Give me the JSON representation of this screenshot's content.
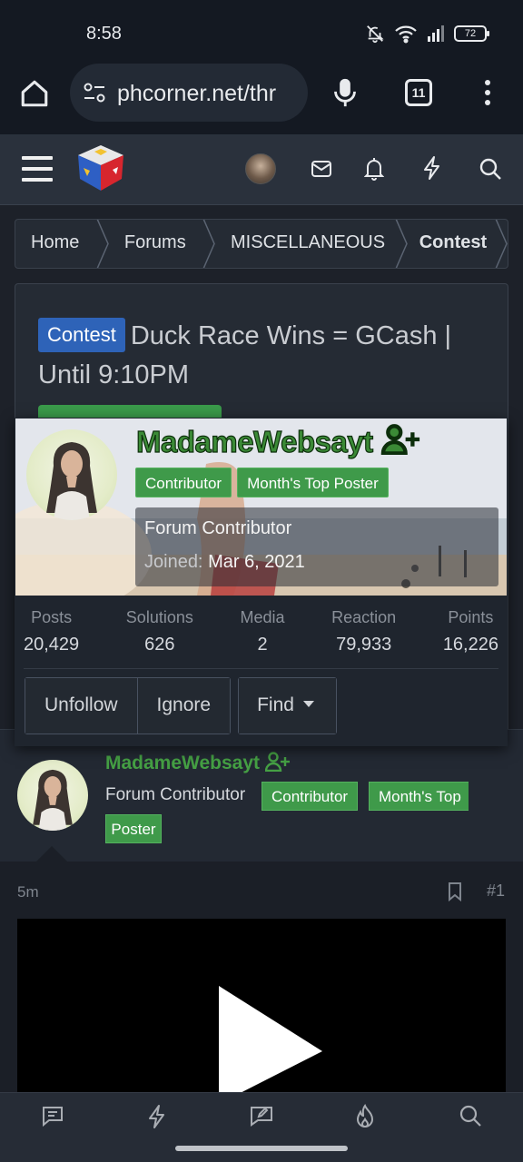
{
  "status_bar": {
    "time": "8:58",
    "battery": "72"
  },
  "browser": {
    "url": "phcorner.net/thr",
    "tab_count": "11"
  },
  "breadcrumb": [
    "Home",
    "Forums",
    "MISCELLANEOUS",
    "Contest"
  ],
  "thread": {
    "prefix": "Contest",
    "title": "Duck Race Wins = GCash | Until 9:10PM"
  },
  "member_card": {
    "username": "MadameWebsayt",
    "badges": [
      "Contributor",
      "Month's Top Poster"
    ],
    "user_title": "Forum Contributor",
    "joined_label": "Joined:",
    "joined_date": "Mar 6, 2021",
    "stats": [
      {
        "label": "Posts",
        "value": "20,429"
      },
      {
        "label": "Solutions",
        "value": "626"
      },
      {
        "label": "Media",
        "value": "2"
      },
      {
        "label": "Reaction",
        "value": "79,933"
      },
      {
        "label": "Points",
        "value": "16,226"
      }
    ],
    "buttons": {
      "unfollow": "Unfollow",
      "ignore": "Ignore",
      "find": "Find"
    }
  },
  "post": {
    "author": "MadameWebsayt",
    "user_title": "Forum Contributor",
    "badge_1": "Contributor",
    "badge_2_line1": "Month's Top",
    "badge_2_line2": "Poster",
    "time": "5m",
    "number": "#1"
  },
  "colors": {
    "accent_green": "#3f9a4a",
    "prefix_blue": "#2e63b8",
    "background": "#1d2129"
  }
}
